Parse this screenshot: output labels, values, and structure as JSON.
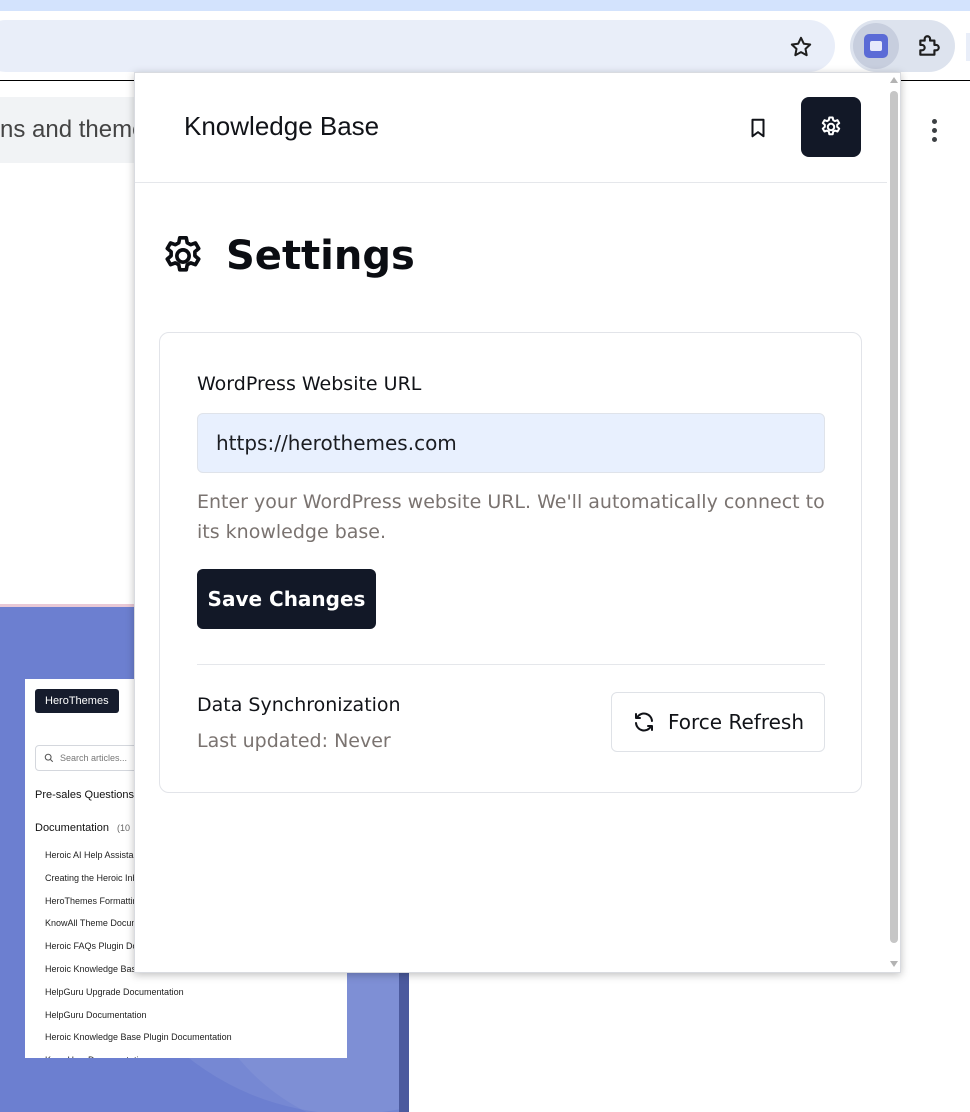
{
  "browser": {
    "star_icon": "star-icon",
    "extension_icon": "knowledge-base-extension-icon",
    "puzzle_icon": "puzzle-icon"
  },
  "background_page": {
    "chip_text": "ns and theme",
    "preview": {
      "logo": "HeroThemes",
      "search_placeholder": "Search articles...",
      "headings": [
        "Pre-sales Questions",
        "Documentation"
      ],
      "doc_count": "(10",
      "items": [
        "Heroic AI Help Assistant",
        "Creating the Heroic Inbox",
        "HeroThemes Formatting",
        "KnowAll Theme Documentation",
        "Heroic FAQs Plugin Documentation",
        "Heroic Knowledge Base",
        "HelpGuru Upgrade Documentation",
        "HelpGuru Documentation",
        "Heroic Knowledge Base Plugin Documentation",
        "KnowHow Documentation"
      ]
    }
  },
  "popup": {
    "brand": "Knowledge Base",
    "title": "Settings",
    "wp_url_label": "WordPress Website URL",
    "wp_url_value": "https://herothemes.com",
    "help_text": "Enter your WordPress website URL. We'll automatically connect to its knowledge base.",
    "save_label": "Save Changes",
    "sync_title": "Data Synchronization",
    "sync_status": "Last updated: Never",
    "refresh_label": "Force Refresh"
  },
  "colors": {
    "primary_dark": "#121827",
    "input_bg": "#e8f0fe",
    "muted_text": "#7a7370",
    "preview_bg": "#6c7fd0"
  }
}
